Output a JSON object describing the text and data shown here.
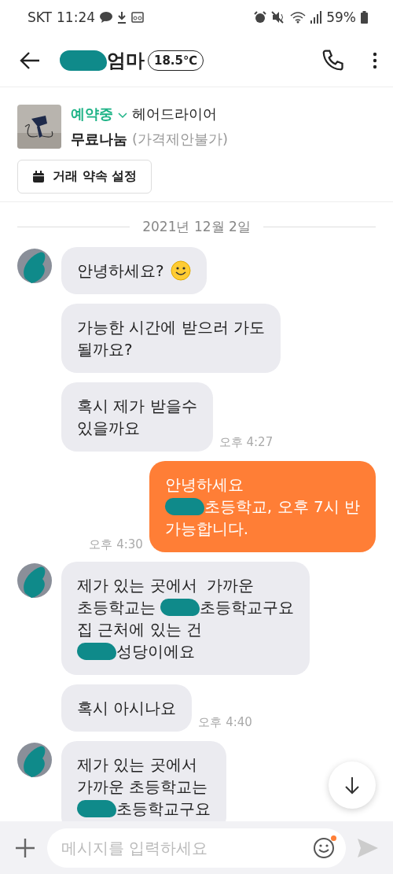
{
  "status_bar": {
    "carrier": "SKT",
    "time": "11:24",
    "battery": "59%"
  },
  "header": {
    "title_redacted": true,
    "title": "엄마",
    "temperature": "18.5℃"
  },
  "product": {
    "status": "예약중",
    "name": "헤어드라이어",
    "price": "무료나눔",
    "price_note": "(가격제안불가)",
    "button": "거래 약속 설정"
  },
  "date": "2021년 12월 2일",
  "messages": [
    {
      "kind": "received",
      "avatar": true,
      "lines": [
        [
          {
            "kind": "text",
            "text": "안녕하세요?"
          },
          {
            "kind": "emoji"
          }
        ]
      ]
    },
    {
      "kind": "received",
      "avatar": false,
      "lines": [
        [
          {
            "kind": "text",
            "text": "가능한 시간에 받으러 가도"
          }
        ],
        [
          {
            "kind": "text",
            "text": "될까요?"
          }
        ]
      ]
    },
    {
      "kind": "received",
      "avatar": false,
      "time": "오후 4:27",
      "lines": [
        [
          {
            "kind": "text",
            "text": "혹시 제가 받을수"
          }
        ],
        [
          {
            "kind": "text",
            "text": "있을까요"
          }
        ]
      ]
    },
    {
      "kind": "sent",
      "avatar": false,
      "time": "오후 4:30",
      "lines": [
        [
          {
            "kind": "text",
            "text": "안녕하세요"
          }
        ],
        [
          {
            "kind": "redaction"
          },
          {
            "kind": "text",
            "text": "초등학교, 오후 7시 반"
          }
        ],
        [
          {
            "kind": "text",
            "text": "가능합니다."
          }
        ]
      ]
    },
    {
      "kind": "received",
      "avatar": true,
      "lines": [
        [
          {
            "kind": "text",
            "text": "제가 있는 곳에서  가까운"
          }
        ],
        [
          {
            "kind": "text",
            "text": "초등학교는 "
          },
          {
            "kind": "redaction"
          },
          {
            "kind": "text",
            "text": "초등학교구요"
          }
        ],
        [
          {
            "kind": "text",
            "text": "집 근처에 있는 건"
          }
        ],
        [
          {
            "kind": "redaction"
          },
          {
            "kind": "text",
            "text": "성당이에요"
          }
        ]
      ]
    },
    {
      "kind": "received",
      "avatar": false,
      "time": "오후 4:40",
      "lines": [
        [
          {
            "kind": "text",
            "text": "혹시 아시나요"
          }
        ]
      ]
    },
    {
      "kind": "received",
      "avatar": true,
      "lines": [
        [
          {
            "kind": "text",
            "text": "제가 있는 곳에서"
          }
        ],
        [
          {
            "kind": "text",
            "text": "가까운 초등학교는"
          }
        ],
        [
          {
            "kind": "redaction"
          },
          {
            "kind": "text",
            "text": "초등학교구요"
          }
        ]
      ]
    }
  ],
  "input": {
    "placeholder": "메시지를 입력하세요",
    "emoji_badge": true
  }
}
